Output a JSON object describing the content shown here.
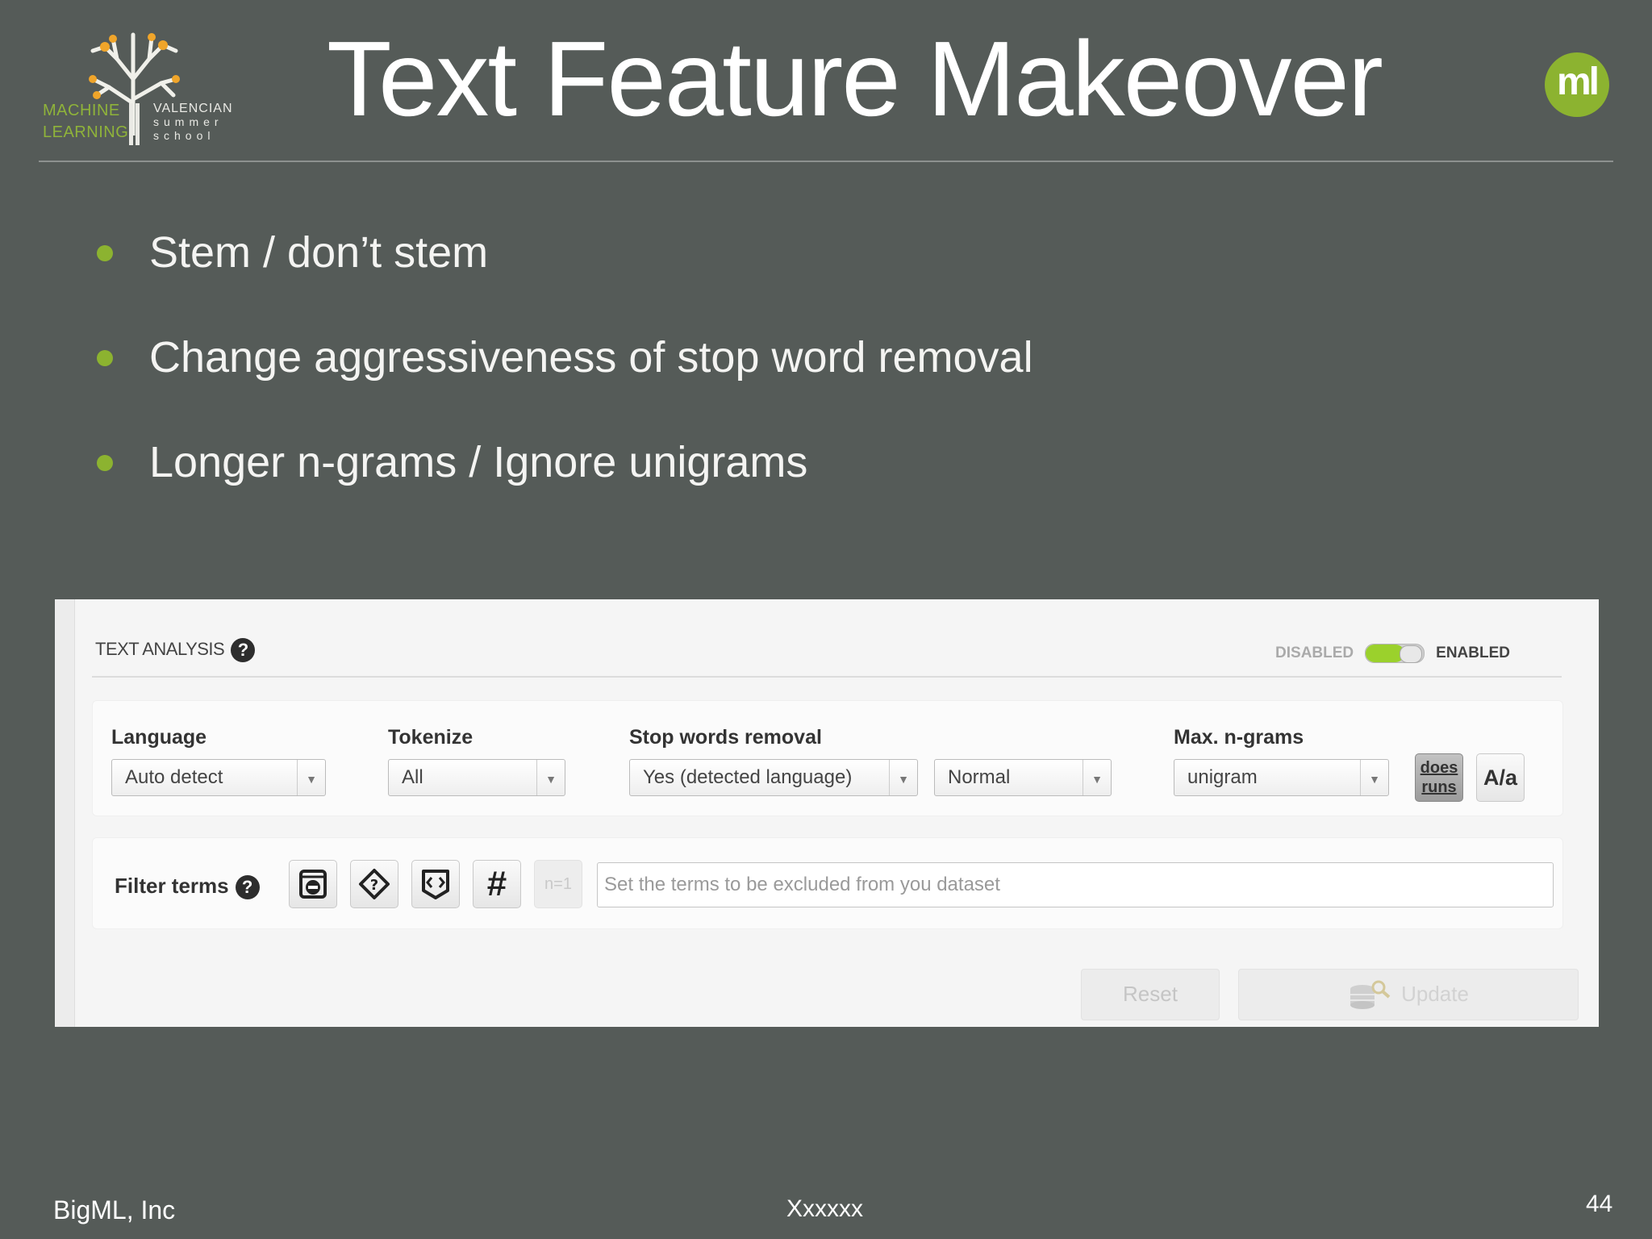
{
  "logo": {
    "left_line1": "MACHINE",
    "left_line2": "LEARNING",
    "right_line1": "VALENCIAN",
    "right_line2": "summer",
    "right_line3": "school"
  },
  "slide": {
    "title": "Text Feature Makeover",
    "badge": "ml",
    "bullets": [
      "Stem / don’t stem",
      "Change aggressiveness of stop word removal",
      "Longer n-grams / Ignore unigrams"
    ]
  },
  "panel": {
    "header": "TEXT ANALYSIS",
    "help_symbol": "?",
    "toggle_disabled": "DISABLED",
    "toggle_enabled": "ENABLED",
    "toggle_state": "enabled",
    "language_label": "Language",
    "language_value": "Auto detect",
    "tokenize_label": "Tokenize",
    "tokenize_value": "All",
    "stopwords_label": "Stop words removal",
    "stopwords_value": "Yes (detected language)",
    "stopwords_level": "Normal",
    "ngrams_label": "Max. n-grams",
    "ngrams_value": "unigram",
    "stem_btn_line1": "does",
    "stem_btn_line2": "runs",
    "case_btn": "A/a",
    "filter_label": "Filter terms",
    "n_equal": "n=1",
    "hash_symbol": "#",
    "filter_placeholder": "Set the terms to be excluded from you dataset",
    "reset_label": "Reset",
    "update_label": "Update"
  },
  "footer": {
    "company": "BigML, Inc",
    "center": "Xxxxxx",
    "page_number": "44"
  },
  "colors": {
    "background": "#555b58",
    "accent_green": "#8cb330",
    "toggle_green": "#9bd12c"
  }
}
